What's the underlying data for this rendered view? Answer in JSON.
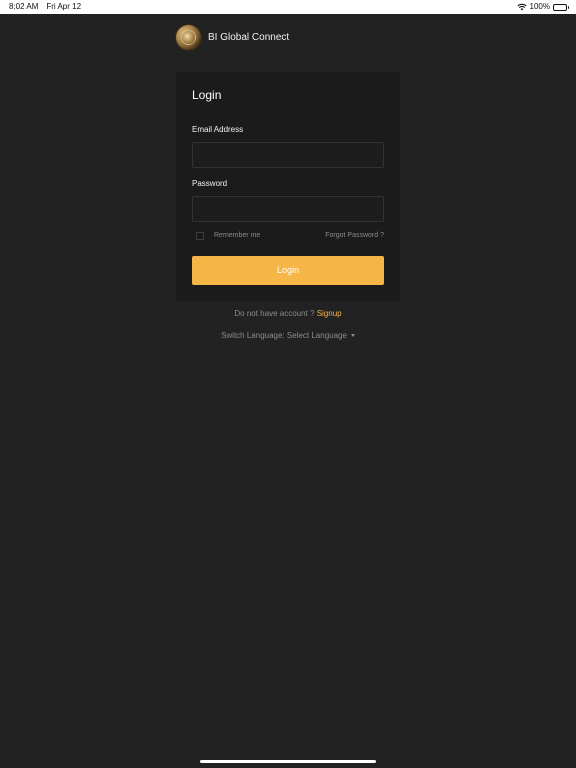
{
  "status_bar": {
    "time": "8:02 AM",
    "date": "Fri Apr 12",
    "battery": "100%",
    "icons": [
      "wifi-icon",
      "battery-icon"
    ]
  },
  "brand": {
    "name": "BI Global Connect",
    "logo": "coin-logo"
  },
  "login_form": {
    "title": "Login",
    "email_label": "Email Address",
    "email_value": "",
    "email_placeholder": "",
    "password_label": "Password",
    "password_value": "",
    "password_placeholder": "",
    "remember_label": "Remember me",
    "remember_checked": false,
    "forgot_label": "Forgot Password ?",
    "submit_label": "Login"
  },
  "signup": {
    "prompt": "Do not have account ?",
    "link_label": "Signup"
  },
  "language": {
    "label": "Switch Language: Select Language"
  },
  "colors": {
    "background": "#222222",
    "card": "#1b1b1b",
    "accent": "#f5b547",
    "muted_text": "#8c8c8c"
  }
}
